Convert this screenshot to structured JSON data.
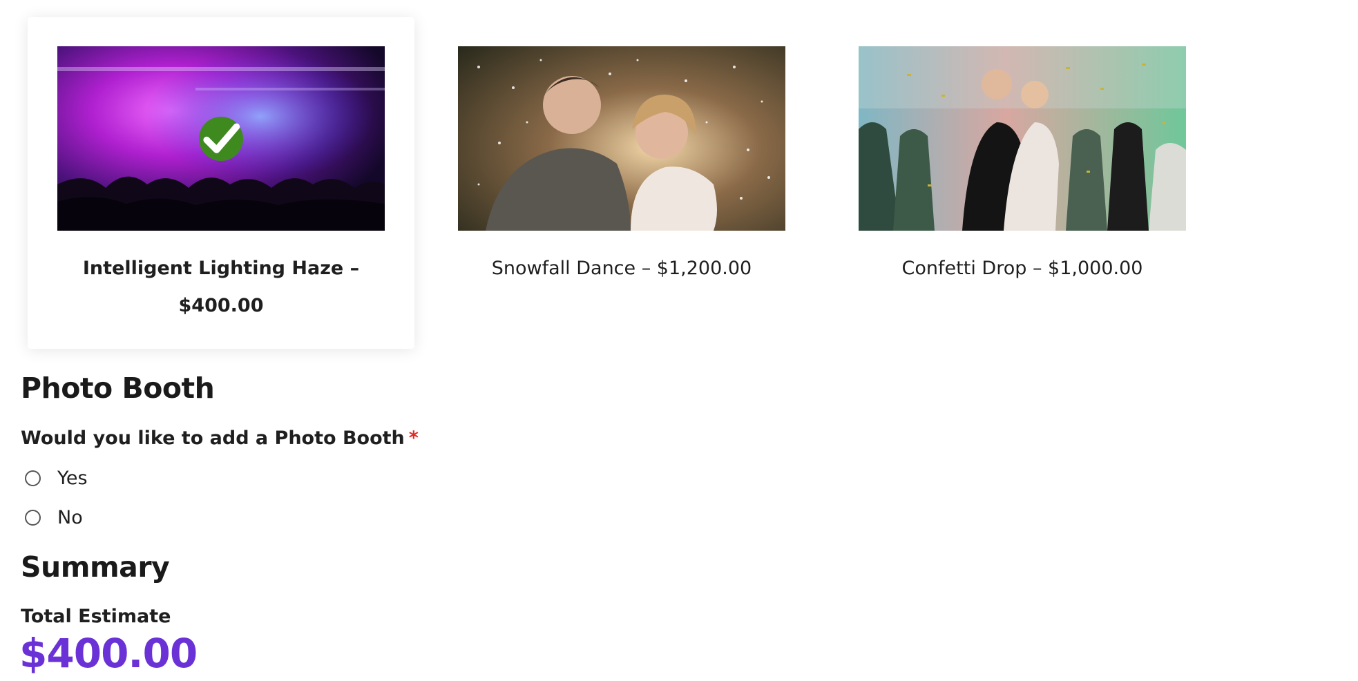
{
  "options": [
    {
      "label": "Intelligent Lighting Haze – $400.00",
      "image_icon": "concert-lighting-photo",
      "selected": true
    },
    {
      "label": "Snowfall Dance – $1,200.00",
      "image_icon": "couple-snowfall-photo",
      "selected": false
    },
    {
      "label": "Confetti Drop – $1,000.00",
      "image_icon": "confetti-dance-photo",
      "selected": false
    }
  ],
  "photo_booth": {
    "title": "Photo Booth",
    "question": "Would you like to add a Photo Booth",
    "required_mark": "*",
    "choices": [
      "Yes",
      "No"
    ]
  },
  "summary": {
    "title": "Summary",
    "total_label": "Total Estimate",
    "total_value": "$400.00"
  },
  "colors": {
    "accent_total": "#6a32d6",
    "required": "#e02b27",
    "check_badge": "#3f8a1f"
  }
}
